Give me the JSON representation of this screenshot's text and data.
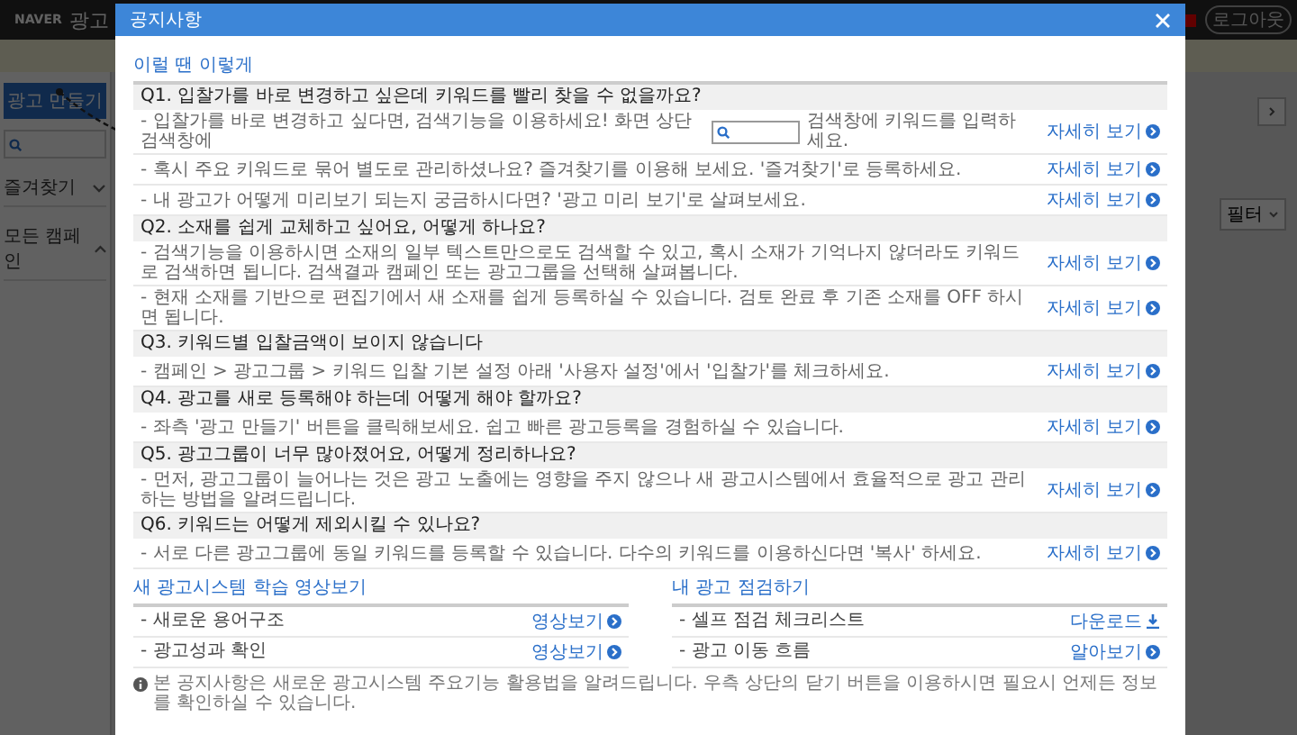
{
  "navbar": {
    "brand": "NAVER",
    "title": "광고",
    "logout": "로그아웃"
  },
  "sidebar": {
    "create_button": "광고 만들기",
    "items": [
      {
        "label": "즐겨찾기",
        "expanded": false
      },
      {
        "label": "모든 캠페인",
        "expanded": true
      }
    ]
  },
  "toolbar": {
    "filter": "필터"
  },
  "dialog": {
    "title": "공지사항",
    "section_title": "이럴 땐 이렇게",
    "faqs": [
      {
        "question": "Q1. 입찰가를 바로 변경하고 싶은데 키워드를 빨리 찾을 수 없을까요?",
        "items": [
          {
            "kind": "search",
            "text": "- 입찰가를 바로 변경하고 싶다면, 검색기능을 이용하세요! 화면 상단 검색창에",
            "text_after": "검색창에 키워드를 입력하세요.",
            "link": "자세히 보기"
          },
          {
            "kind": "text",
            "text": "- 혹시 주요 키워드로 묶어 별도로 관리하셨나요? 즐겨찾기를 이용해 보세요. '즐겨찾기'로 등록하세요.",
            "link": "자세히 보기"
          },
          {
            "kind": "text",
            "text": "- 내 광고가 어떻게 미리보기 되는지 궁금하시다면? '광고 미리 보기'로 살펴보세요.",
            "link": "자세히 보기"
          }
        ]
      },
      {
        "question": "Q2. 소재를 쉽게 교체하고 싶어요, 어떻게 하나요?",
        "items": [
          {
            "kind": "text",
            "text": "- 검색기능을 이용하시면 소재의 일부 텍스트만으로도 검색할 수 있고, 혹시 소재가 기억나지 않더라도 키워드로 검색하면 됩니다. 검색결과 캠페인 또는 광고그룹을 선택해 살펴봅니다.",
            "link": "자세히 보기"
          },
          {
            "kind": "text",
            "text": "- 현재 소재를 기반으로 편집기에서 새 소재를 쉽게 등록하실 수 있습니다. 검토 완료 후 기존 소재를 OFF 하시면 됩니다.",
            "link": "자세히 보기"
          }
        ]
      },
      {
        "question": "Q3. 키워드별 입찰금액이 보이지 않습니다",
        "items": [
          {
            "kind": "text",
            "text": "- 캠페인 > 광고그룹 > 키워드 입찰 기본 설정 아래 '사용자 설정'에서 '입찰가'를 체크하세요.",
            "link": "자세히 보기"
          }
        ]
      },
      {
        "question": "Q4. 광고를 새로 등록해야 하는데 어떻게 해야 할까요?",
        "items": [
          {
            "kind": "text",
            "text": "- 좌측 '광고 만들기' 버튼을 클릭해보세요. 쉽고 빠른 광고등록을 경험하실 수 있습니다.",
            "link": "자세히 보기"
          }
        ]
      },
      {
        "question": "Q5. 광고그룹이 너무 많아졌어요, 어떻게 정리하나요?",
        "items": [
          {
            "kind": "text",
            "text": "- 먼저, 광고그룹이 늘어나는 것은 광고 노출에는 영향을 주지 않으나 새 광고시스템에서 효율적으로 광고 관리하는 방법을 알려드립니다.",
            "link": "자세히 보기"
          }
        ]
      },
      {
        "question": "Q6. 키워드는 어떻게 제외시킬 수 있나요?",
        "items": [
          {
            "kind": "text",
            "text": "- 서로 다른 광고그룹에 동일 키워드를 등록할 수 있습니다. 다수의 키워드를 이용하신다면 '복사' 하세요.",
            "link": "자세히 보기"
          }
        ]
      }
    ],
    "panels": [
      {
        "title": "새 광고시스템 학습 영상보기",
        "rows": [
          {
            "label": "- 새로운 용어구조",
            "link": "영상보기",
            "kind": "go"
          },
          {
            "label": "- 광고성과 확인",
            "link": "영상보기",
            "kind": "go"
          }
        ]
      },
      {
        "title": "내 광고 점검하기",
        "rows": [
          {
            "label": "- 셀프 점검 체크리스트",
            "link": "다운로드",
            "kind": "download"
          },
          {
            "label": "- 광고 이동 흐름",
            "link": "알아보기",
            "kind": "go"
          }
        ]
      }
    ],
    "footer": "본 공지사항은 새로운 광고시스템 주요기능 활용법을 알려드립니다. 우측 상단의 닫기 버튼을 이용하시면 필요시 언제든 정보를 확인하실 수 있습니다."
  }
}
